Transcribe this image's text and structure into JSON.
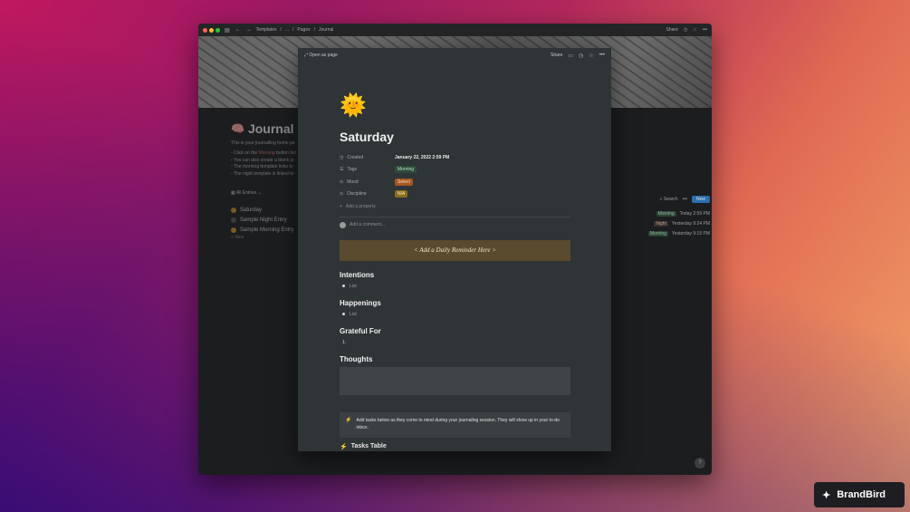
{
  "titlebar": {
    "breadcrumbs": [
      "Templates",
      "...",
      "Pages",
      "Journal"
    ],
    "share": "Share"
  },
  "background_page": {
    "title": "Journal",
    "description": "This is your journalling home pa",
    "bullets": [
      "- Click on the",
      "- You can also create a blank jo",
      "- The morning template links to",
      "- The night template is linked to"
    ],
    "click_button_text": "button loo",
    "view_label": "All Entries",
    "entries": [
      "Saturday",
      "Sample Night Entry",
      "Sample Morning Entry"
    ],
    "new_label": "New",
    "toolbar": {
      "search": "Search",
      "new": "New"
    },
    "right_rows": [
      {
        "tag": "Morning",
        "date": "Today 2:59 PM"
      },
      {
        "tag": "Night",
        "date": "Yesterday 9:24 PM"
      },
      {
        "tag": "Morning",
        "date": "Yesterday 9:15 PM"
      }
    ]
  },
  "modal": {
    "open_as_page": "Open as page",
    "share": "Share",
    "page_icon": "🌞",
    "title": "Saturday",
    "properties": {
      "created": {
        "label": "Created",
        "value": "January 22, 2022 2:59 PM"
      },
      "tags": {
        "label": "Tags",
        "value": "Morning"
      },
      "mood": {
        "label": "Mood",
        "value": "Select"
      },
      "discipline": {
        "label": "Discipline",
        "value": "N/A"
      }
    },
    "add_property": "Add a property",
    "add_comment": "Add a comment...",
    "banner": "< Add a Daily Reminder Here >",
    "sections": {
      "intentions": {
        "heading": "Intentions",
        "item": "List"
      },
      "happenings": {
        "heading": "Happenings",
        "item": "List"
      },
      "grateful": {
        "heading": "Grateful For",
        "item": "1."
      },
      "thoughts": {
        "heading": "Thoughts"
      }
    },
    "callout": "Add tasks below as they come to mind during your journaling session. They will show up in your to-do inbox.",
    "cutoff_heading": "Tasks Table"
  },
  "help": "?",
  "brand": "BrandBird",
  "colors": {
    "modal_bg": "#2f3437",
    "banner_bg": "#5a4a2e",
    "morning_pill": "#2f4a3a",
    "select_pill": "#a4561e",
    "na_pill": "#8a6d1f",
    "accent_blue": "#2e7ec4"
  }
}
